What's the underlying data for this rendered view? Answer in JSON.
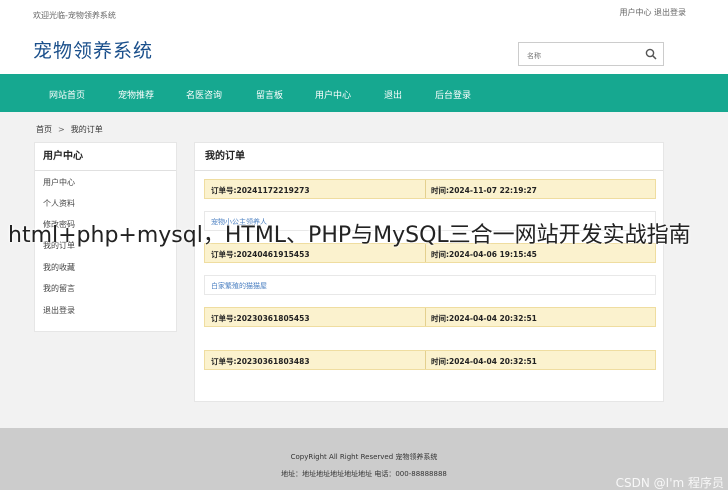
{
  "topbar": {
    "welcome": "欢迎光临-宠物领养系统",
    "links": "用户中心 退出登录"
  },
  "header": {
    "logo": "宠物领养系统",
    "search_placeholder": "名称"
  },
  "nav": {
    "items": [
      "网站首页",
      "宠物推荐",
      "名医咨询",
      "留言板",
      "用户中心",
      "退出",
      "后台登录"
    ]
  },
  "breadcrumb": {
    "home": "首页",
    "sep": ">",
    "current": "我的订单"
  },
  "sidebar": {
    "title": "用户中心",
    "items": [
      "用户中心",
      "个人资料",
      "修改密码",
      "我的订单",
      "我的收藏",
      "我的留言",
      "退出登录"
    ]
  },
  "main": {
    "title": "我的订单",
    "orders": [
      {
        "no": "订单号:20241172219273",
        "time": "时间:2024-11-07 22:19:27",
        "shop": "宠物小公主领养人"
      },
      {
        "no": "订单号:20240461915453",
        "time": "时间:2024-04-06 19:15:45",
        "shop": "白家繁殖的猫猫屋"
      },
      {
        "no": "订单号:20230361805453",
        "time": "时间:2024-04-04 20:32:51"
      },
      {
        "no": "订单号:20230361803483",
        "time": "时间:2024-04-04 20:32:51"
      }
    ]
  },
  "footer": {
    "line1": "CopyRight All Right Reserved 宠物领养系统",
    "line2": "地址：地址地址地址地址地址 电话：000-88888888"
  },
  "watermark": {
    "overlay": "html+php+mysql，HTML、PHP与MySQL三合一网站开发实战指南",
    "csdn": "CSDN @I'm 程序员"
  },
  "colors": {
    "nav": "#16a890",
    "logo": "#1a4f8b",
    "order_bg": "#fbf2ce",
    "footer": "#cccccc"
  }
}
